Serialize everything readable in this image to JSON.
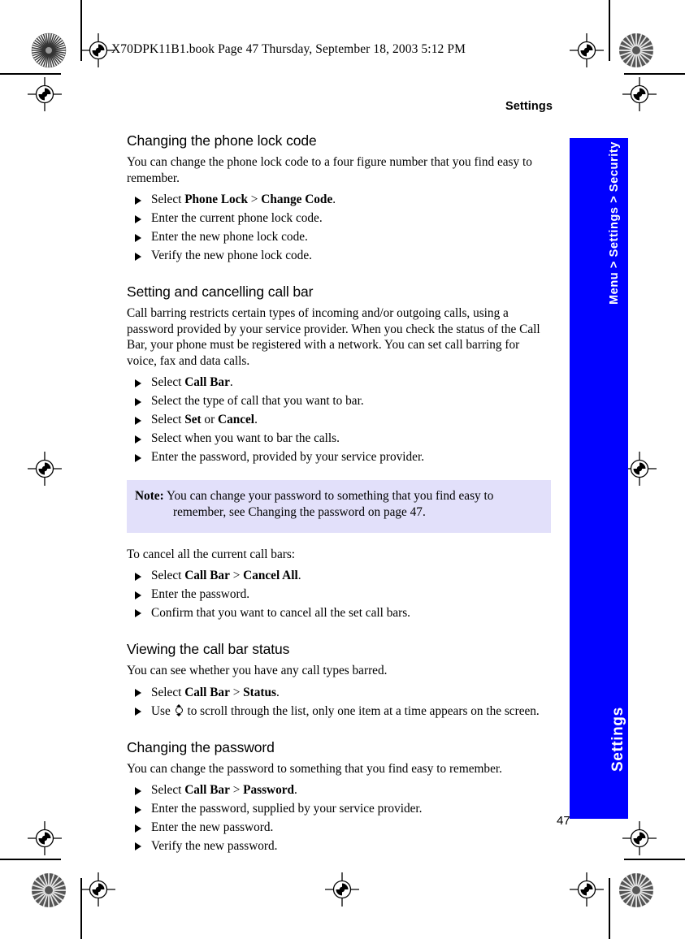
{
  "print_marks": {
    "meta_header": "X70DPK11B1.book  Page 47  Thursday, September 18, 2003  5:12 PM",
    "registration_icon": "registration-target-icon",
    "star_target_icon": "star-density-target-icon"
  },
  "page": {
    "running_head": "Settings",
    "page_number": "47",
    "side_tab": {
      "breadcrumb": "Menu > Settings > Security",
      "section_title": "Settings",
      "color": "#0000FF",
      "text_color": "#FFFFFF"
    },
    "note_box": {
      "background": "#E2E0FA",
      "label": "Note:",
      "text": " You can change your password to something that you find easy to remember, see Changing the password on page 47."
    },
    "sections": [
      {
        "heading": "Changing the phone lock code",
        "intro": "You can change the phone lock code to a four figure number that you find easy to remember.",
        "steps": [
          {
            "pre": "Select ",
            "b1": "Phone Lock",
            "mid": " > ",
            "b2": "Change Code",
            "post": "."
          },
          {
            "pre": "Enter the current phone lock code.",
            "b1": "",
            "mid": "",
            "b2": "",
            "post": ""
          },
          {
            "pre": "Enter the new phone lock code.",
            "b1": "",
            "mid": "",
            "b2": "",
            "post": ""
          },
          {
            "pre": "Verify the new phone lock code.",
            "b1": "",
            "mid": "",
            "b2": "",
            "post": ""
          }
        ]
      },
      {
        "heading": "Setting and cancelling call bar",
        "intro": "Call barring restricts certain types of incoming and/or outgoing calls, using a password provided by your service provider. When you check the status of the Call Bar, your phone must be registered with a network. You can set call barring for voice, fax and data calls.",
        "steps": [
          {
            "pre": "Select ",
            "b1": "Call Bar",
            "mid": "",
            "b2": "",
            "post": "."
          },
          {
            "pre": "Select the type of call that you want to bar.",
            "b1": "",
            "mid": "",
            "b2": "",
            "post": ""
          },
          {
            "pre": "Select ",
            "b1": "Set",
            "mid": " or ",
            "b2": "Cancel",
            "post": "."
          },
          {
            "pre": "Select when you want to bar the calls.",
            "b1": "",
            "mid": "",
            "b2": "",
            "post": ""
          },
          {
            "pre": "Enter the password, provided by your service provider.",
            "b1": "",
            "mid": "",
            "b2": "",
            "post": ""
          }
        ]
      },
      {
        "heading": "",
        "intro": "To cancel all the current call bars:",
        "steps": [
          {
            "pre": "Select ",
            "b1": "Call Bar",
            "mid": " > ",
            "b2": "Cancel All",
            "post": "."
          },
          {
            "pre": "Enter the password.",
            "b1": "",
            "mid": "",
            "b2": "",
            "post": ""
          },
          {
            "pre": "Confirm that you want to cancel all the set call bars.",
            "b1": "",
            "mid": "",
            "b2": "",
            "post": ""
          }
        ]
      },
      {
        "heading": "Viewing the call bar status",
        "intro": "You can see whether you have any call types barred.",
        "steps": [
          {
            "pre": "Select ",
            "b1": "Call Bar",
            "mid": " > ",
            "b2": "Status",
            "post": "."
          }
        ],
        "nav_step": {
          "pre": "Use ",
          "icon": "nav-scroll-key-icon",
          "post": " to scroll through the list, only one item at a time appears on the screen."
        }
      },
      {
        "heading": "Changing the password",
        "intro": "You can change the password to something that you find easy to remember.",
        "steps": [
          {
            "pre": "Select ",
            "b1": "Call Bar",
            "mid": " > ",
            "b2": "Password",
            "post": "."
          },
          {
            "pre": "Enter the password, supplied by your service provider.",
            "b1": "",
            "mid": "",
            "b2": "",
            "post": ""
          },
          {
            "pre": "Enter the new password.",
            "b1": "",
            "mid": "",
            "b2": "",
            "post": ""
          },
          {
            "pre": "Verify the new password.",
            "b1": "",
            "mid": "",
            "b2": "",
            "post": ""
          }
        ]
      }
    ]
  }
}
